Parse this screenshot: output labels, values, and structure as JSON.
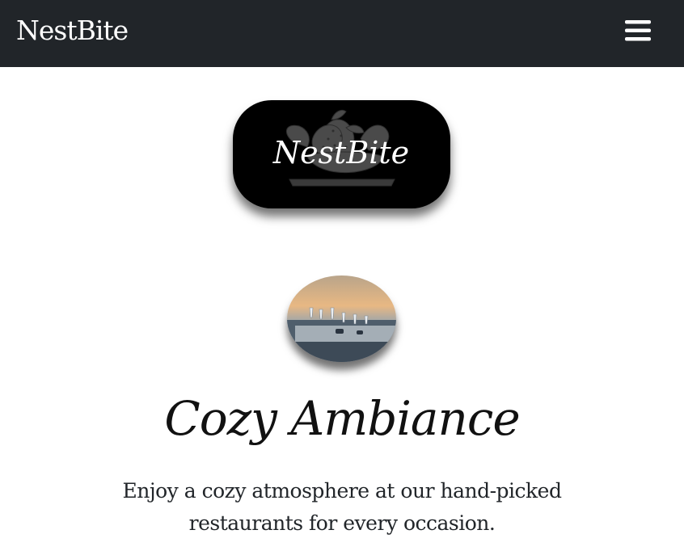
{
  "navbar": {
    "brand": "NestBite",
    "menu_icon": "hamburger-menu-icon",
    "background": "#212529"
  },
  "logo": {
    "text": "NestBite",
    "icon": "strawberry-illustration"
  },
  "feature": {
    "image": "restaurant-table-photo",
    "title": "Cozy Ambiance",
    "description": "Enjoy a cozy atmosphere at our hand-picked restaurants for every occasion."
  }
}
